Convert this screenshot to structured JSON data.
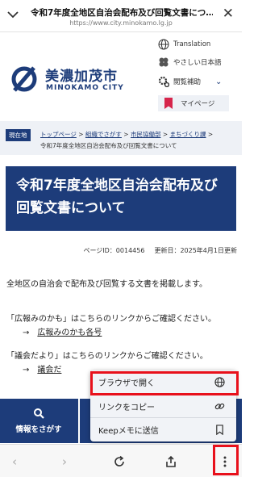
{
  "browser": {
    "tab_title": "令和7年度全地区自治会配布及び回覧文書につ…",
    "url": "https://www.city.minokamo.lg.jp"
  },
  "site": {
    "name_jp": "美濃加茂市",
    "name_en": "MINOKAMO CITY",
    "translation_label": "Translation",
    "easy_japanese_label": "やさしい日本語",
    "reading_aid_label": "閲覧補助",
    "mypage_label": "マイページ"
  },
  "breadcrumb": {
    "here_label": "現在地",
    "items": [
      "トップページ",
      "組織でさがす",
      "市民協働部",
      "まちづくり課"
    ],
    "current": "令和7年度全地区自治会配布及び回覧文書について"
  },
  "page": {
    "title": "令和7年度全地区自治会配布及び回覧文書について",
    "page_id": "ページID：0014456",
    "updated": "更新日：2025年4月1日更新",
    "intro": "全地区の自治会で配布及び回覧する文書を掲載します。",
    "para2_text": "「広報みのかも」はこちらのリンクからご確認ください。",
    "para2_link": "広報みのかも各号",
    "para3_text": "「議会だより」はこちらのリンクからご確認ください。",
    "para3_link": "議会だ"
  },
  "tiles": {
    "search_label": "情報をさがす"
  },
  "context_menu": {
    "open_in_browser": "ブラウザで開く",
    "copy_link": "リンクをコピー",
    "send_to_keep": "Keepメモに送信"
  },
  "colors": {
    "brand_navy": "#1d3c7a",
    "highlight_red": "#e8101b"
  }
}
